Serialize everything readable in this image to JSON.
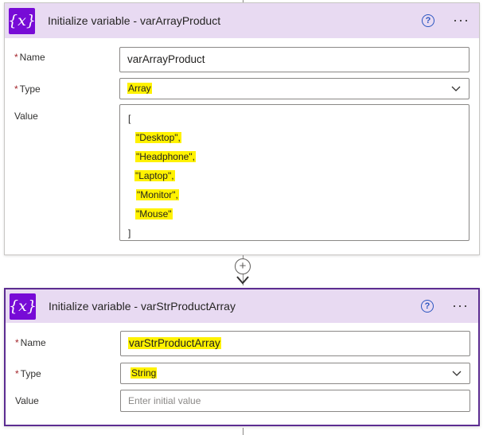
{
  "colors": {
    "accent": "#770bd6",
    "header_bg": "#e8daf2",
    "selected_border": "#5c2d91",
    "highlight": "#fff200"
  },
  "icons": {
    "variable": "variable-icon",
    "help": "help-icon",
    "more": "more-icon",
    "chevron": "chevron-down-icon",
    "add": "plus-icon"
  },
  "card1": {
    "icon_glyph": "{x}",
    "title": "Initialize variable - varArrayProduct",
    "help_glyph": "?",
    "more_glyph": "···",
    "name_label": "Name",
    "name_value": "varArrayProduct",
    "type_label": "Type",
    "type_value": "Array",
    "value_label": "Value",
    "value_lines": [
      "[",
      "\"Desktop\",",
      "\"Headphone\",",
      "\"Laptop\",",
      "\"Monitor\",",
      "\"Mouse\"",
      "]"
    ]
  },
  "add_glyph": "+",
  "card2": {
    "icon_glyph": "{x}",
    "title": "Initialize variable - varStrProductArray",
    "help_glyph": "?",
    "more_glyph": "···",
    "name_label": "Name",
    "name_value": "varStrProductArray",
    "type_label": "Type",
    "type_value": "String",
    "value_label": "Value",
    "value_placeholder": "Enter initial value"
  },
  "required_mark": "*"
}
